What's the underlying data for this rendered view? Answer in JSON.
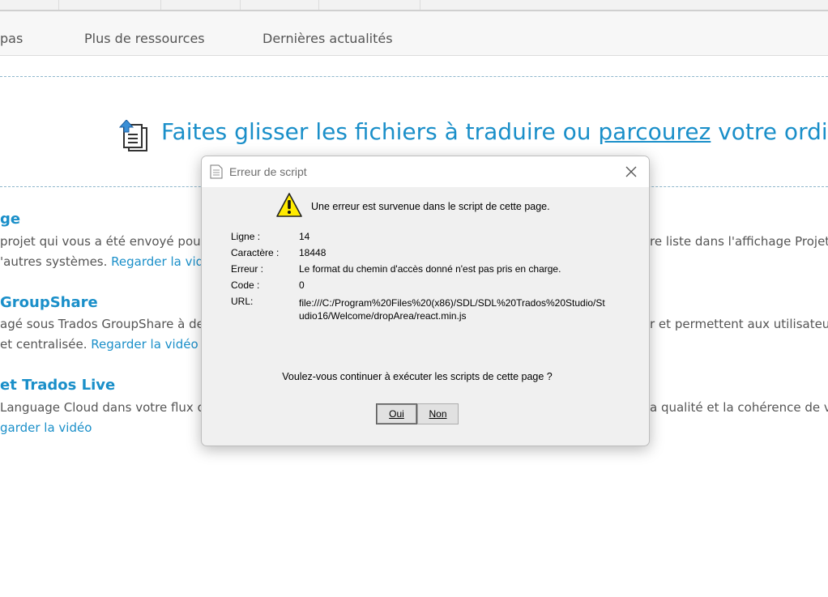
{
  "nav": {
    "tabs": [
      "pas",
      "Plus de ressources",
      "Dernières actualités"
    ]
  },
  "drop_area": {
    "text_before": "Faites glisser les fichiers à traduire ou ",
    "link_text": "parcourez",
    "text_after": " votre ordina",
    "icon": "upload-document-icon"
  },
  "sections": [
    {
      "heading": "ge",
      "line1_left": "projet qui vous a été envoyé pour",
      "line1_right": "re liste dans l'affichage Projets.",
      "line2_text": "'autres systèmes. ",
      "line2_link": "Regarder la vidéo"
    },
    {
      "heading": "GroupShare",
      "line1_left": "agé sous Trados GroupShare à des",
      "line1_right": "r et permettent aux utilisateurs",
      "line2_text": "et centralisée. ",
      "line2_link": "Regarder la vidéo"
    },
    {
      "heading": "et Trados Live",
      "line1_left": "Language Cloud dans votre flux de",
      "line1_right": "a qualité et la cohérence de vot",
      "line2_text": "",
      "line2_link": "garder la vidéo"
    }
  ],
  "dialog": {
    "title": "Erreur de script",
    "title_icon": "document-icon",
    "close_icon": "close-icon",
    "warning_icon": "warning-icon",
    "message": "Une erreur est survenue dans le script de cette page.",
    "fields": [
      {
        "label": "Ligne :",
        "value": "14"
      },
      {
        "label": "Caractère :",
        "value": "18448"
      },
      {
        "label": "Erreur :",
        "value": "Le format du chemin d'accès donné n'est pas pris en charge."
      },
      {
        "label": "Code :",
        "value": "0"
      },
      {
        "label": "URL:",
        "value": "file:///C:/Program%20Files%20(x86)/SDL/SDL%20Trados%20Studio/Studio16/Welcome/dropArea/react.min.js"
      }
    ],
    "question": "Voulez-vous continuer à exécuter les scripts de cette page ?",
    "yes_label": "Oui",
    "no_label": "Non"
  },
  "colors": {
    "accent": "#1a8fc9",
    "warning": "#ffeb00"
  }
}
